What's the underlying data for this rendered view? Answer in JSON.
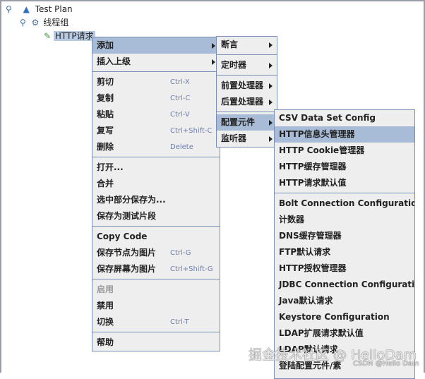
{
  "tree": {
    "root": "Test Plan",
    "group": "线程组",
    "sampler": "HTTP请求"
  },
  "menu1": [
    {
      "label": "添加",
      "submenu": true,
      "highlight": true
    },
    {
      "label": "插入上级",
      "submenu": true
    },
    {
      "sep": true
    },
    {
      "label": "剪切",
      "shortcut": "Ctrl-X"
    },
    {
      "label": "复制",
      "shortcut": "Ctrl-C"
    },
    {
      "label": "粘贴",
      "shortcut": "Ctrl-V"
    },
    {
      "label": "复写",
      "shortcut": "Ctrl+Shift-C"
    },
    {
      "label": "删除",
      "shortcut": "Delete"
    },
    {
      "sep": true
    },
    {
      "label": "打开..."
    },
    {
      "label": "合并"
    },
    {
      "label": "选中部分保存为..."
    },
    {
      "label": "保存为测试片段"
    },
    {
      "sep": true
    },
    {
      "label": "Copy Code"
    },
    {
      "label": "保存节点为图片",
      "shortcut": "Ctrl-G"
    },
    {
      "label": "保存屏幕为图片",
      "shortcut": "Ctrl+Shift-G"
    },
    {
      "sep": true
    },
    {
      "label": "启用",
      "disabled": true
    },
    {
      "label": "禁用"
    },
    {
      "label": "切换",
      "shortcut": "Ctrl-T"
    },
    {
      "sep": true
    },
    {
      "label": "帮助"
    }
  ],
  "menu2": [
    {
      "label": "断言",
      "submenu": true
    },
    {
      "sep": true
    },
    {
      "label": "定时器",
      "submenu": true
    },
    {
      "sep": true
    },
    {
      "label": "前置处理器",
      "submenu": true
    },
    {
      "label": "后置处理器",
      "submenu": true
    },
    {
      "sep": true
    },
    {
      "label": "配置元件",
      "submenu": true,
      "highlight": true
    },
    {
      "label": "监听器",
      "submenu": true
    }
  ],
  "menu3": [
    {
      "label": "CSV Data Set Config"
    },
    {
      "label": "HTTP信息头管理器",
      "highlight": true
    },
    {
      "label": "HTTP Cookie管理器"
    },
    {
      "label": "HTTP缓存管理器"
    },
    {
      "label": "HTTP请求默认值"
    },
    {
      "sep": true
    },
    {
      "label": "Bolt Connection Configuration"
    },
    {
      "label": "计数器"
    },
    {
      "label": "DNS缓存管理器"
    },
    {
      "label": "FTP默认请求"
    },
    {
      "label": "HTTP授权管理器"
    },
    {
      "label": "JDBC Connection Configuration"
    },
    {
      "label": "Java默认请求"
    },
    {
      "label": "Keystore Configuration"
    },
    {
      "label": "LDAP扩展请求默认值"
    },
    {
      "label": "LDAP默认请求"
    },
    {
      "label": "登陆配置元件/素"
    }
  ],
  "watermark": {
    "main": "掘金技术社区 @ HelloDam",
    "csdn": "CSDN @Hello Dam"
  }
}
